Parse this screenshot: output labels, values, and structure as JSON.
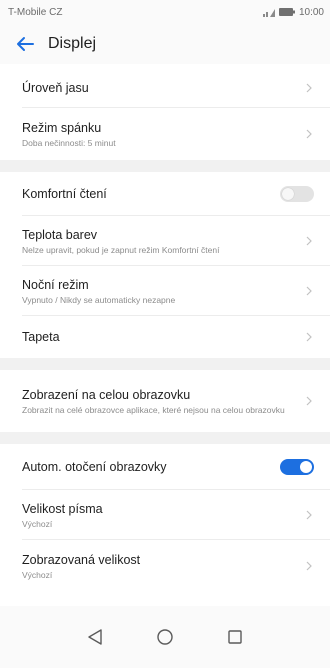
{
  "status_bar": {
    "carrier": "T-Mobile CZ",
    "time": "10:00"
  },
  "header": {
    "title": "Displej",
    "back_icon": "back-arrow-icon"
  },
  "colors": {
    "accent": "#1d6fe0",
    "band": "#f1f1f1"
  },
  "groups": [
    {
      "rows": [
        {
          "title": "Úroveň jasu"
        },
        {
          "title": "Režim spánku",
          "subtitle": "Doba nečinnosti: 5 minut"
        }
      ]
    },
    {
      "rows": [
        {
          "title": "Komfortní čtení",
          "toggle": "off"
        },
        {
          "title": "Teplota barev",
          "subtitle": "Nelze upravit, pokud je zapnut režim Komfortní čtení"
        },
        {
          "title": "Noční režim",
          "subtitle": "Vypnuto / Nikdy se automaticky nezapne"
        },
        {
          "title": "Tapeta"
        }
      ]
    },
    {
      "rows": [
        {
          "title": "Zobrazení na celou obrazovku",
          "subtitle": "Zobrazit na celé obrazovce aplikace, které nejsou na celou obrazovku"
        }
      ]
    },
    {
      "rows": [
        {
          "title": "Autom. otočení obrazovky",
          "toggle": "on"
        },
        {
          "title": "Velikost písma",
          "subtitle": "Výchozí"
        },
        {
          "title": "Zobrazovaná velikost",
          "subtitle": "Výchozí"
        }
      ]
    }
  ],
  "nav_bar": {
    "back": "triangle-back-icon",
    "home": "circle-home-icon",
    "recents": "square-recents-icon"
  }
}
